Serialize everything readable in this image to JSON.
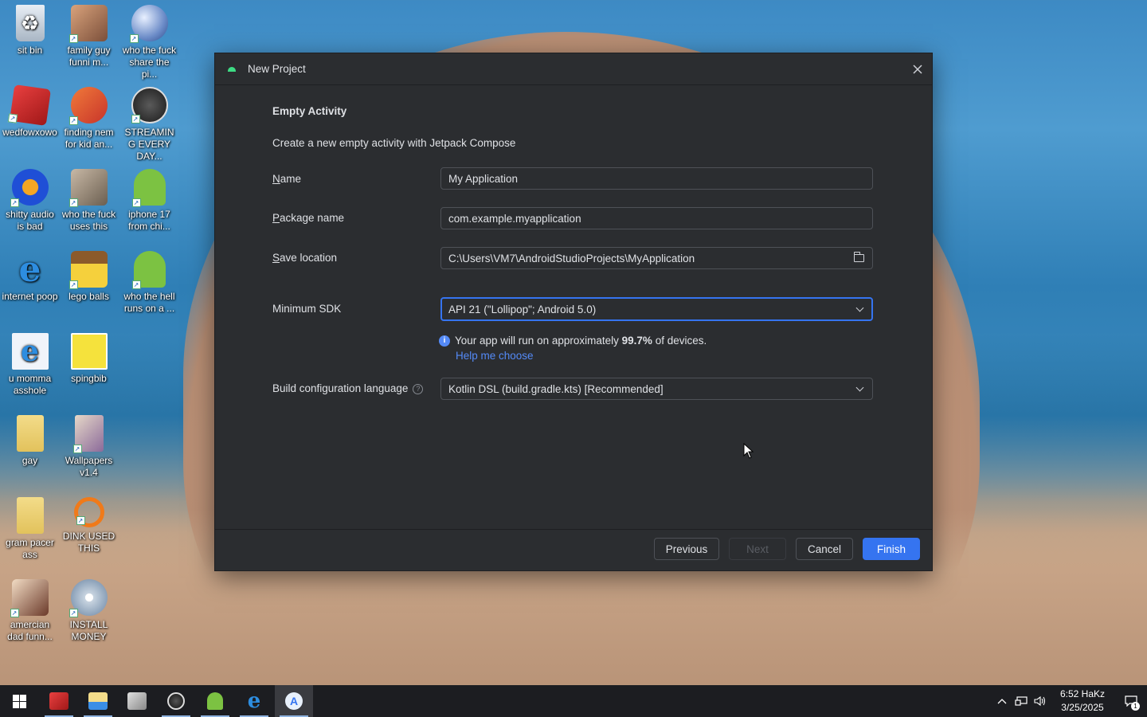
{
  "desktop": {
    "icons": [
      {
        "label": "sit bin",
        "icon": "recycle-bin-icon"
      },
      {
        "label": "family guy funni m...",
        "icon": "video-icon"
      },
      {
        "label": "who the fuck share the pi...",
        "icon": "globe-icon"
      },
      {
        "label": "wedfowxowo",
        "icon": "app-icon"
      },
      {
        "label": "finding nem for kid an...",
        "icon": "video-icon"
      },
      {
        "label": "STREAMING EVERY DAY...",
        "icon": "obs-icon"
      },
      {
        "label": "shitty audio is bad",
        "icon": "audacity-icon"
      },
      {
        "label": "who the fuck uses this",
        "icon": "gimp-icon"
      },
      {
        "label": "iphone 17 from chi...",
        "icon": "android-icon"
      },
      {
        "label": "internet poop",
        "icon": "internet-explorer-icon"
      },
      {
        "label": "lego balls",
        "icon": "game-icon"
      },
      {
        "label": "who the hell runs on a ...",
        "icon": "android-icon"
      },
      {
        "label": "u momma asshole",
        "icon": "internet-explorer-icon"
      },
      {
        "label": "spingbib",
        "icon": "image-icon"
      },
      {
        "label": "gay",
        "icon": "folder-icon"
      },
      {
        "label": "Wallpapers v1.4",
        "icon": "archive-icon"
      },
      {
        "label": "gram pacer ass",
        "icon": "folder-icon"
      },
      {
        "label": "DINK USED THIS",
        "icon": "app-icon"
      },
      {
        "label": "amercian dad funn...",
        "icon": "video-icon"
      },
      {
        "label": "INSTALL MONEY",
        "icon": "installer-icon"
      }
    ]
  },
  "dialog": {
    "title": "New Project",
    "heading": "Empty Activity",
    "description": "Create a new empty activity with Jetpack Compose",
    "fields": {
      "name": {
        "label_first": "N",
        "label_rest": "ame",
        "value": "My Application"
      },
      "package": {
        "label_first": "P",
        "label_rest": "ackage name",
        "value": "com.example.myapplication"
      },
      "save_location": {
        "label_first": "S",
        "label_rest": "ave location",
        "value": "C:\\Users\\VM7\\AndroidStudioProjects\\MyApplication"
      },
      "min_sdk": {
        "label": "Minimum SDK",
        "value": "API 21 (\"Lollipop\"; Android 5.0)"
      },
      "build_lang": {
        "label": "Build configuration language",
        "value": "Kotlin DSL (build.gradle.kts) [Recommended]"
      }
    },
    "info": {
      "prefix": "Your app will run on approximately",
      "percent": "99.7%",
      "suffix": "of devices.",
      "help_link": "Help me choose"
    },
    "buttons": {
      "previous": "Previous",
      "next": "Next",
      "cancel": "Cancel",
      "finish": "Finish"
    },
    "colors": {
      "accent": "#3574f0",
      "background": "#2b2d30",
      "link": "#548af7"
    }
  },
  "taskbar": {
    "apps": [
      {
        "name": "start",
        "icon": "windows-start-icon"
      },
      {
        "name": "app",
        "icon": "app-icon"
      },
      {
        "name": "file-explorer",
        "icon": "folder-icon"
      },
      {
        "name": "installer",
        "icon": "installer-icon"
      },
      {
        "name": "obs",
        "icon": "obs-icon"
      },
      {
        "name": "android",
        "icon": "android-icon"
      },
      {
        "name": "internet-explorer",
        "icon": "internet-explorer-icon"
      },
      {
        "name": "android-studio",
        "icon": "android-studio-icon"
      }
    ],
    "clock": {
      "time": "6:52 HaKz",
      "date": "3/25/2025"
    },
    "notification_count": "1"
  }
}
